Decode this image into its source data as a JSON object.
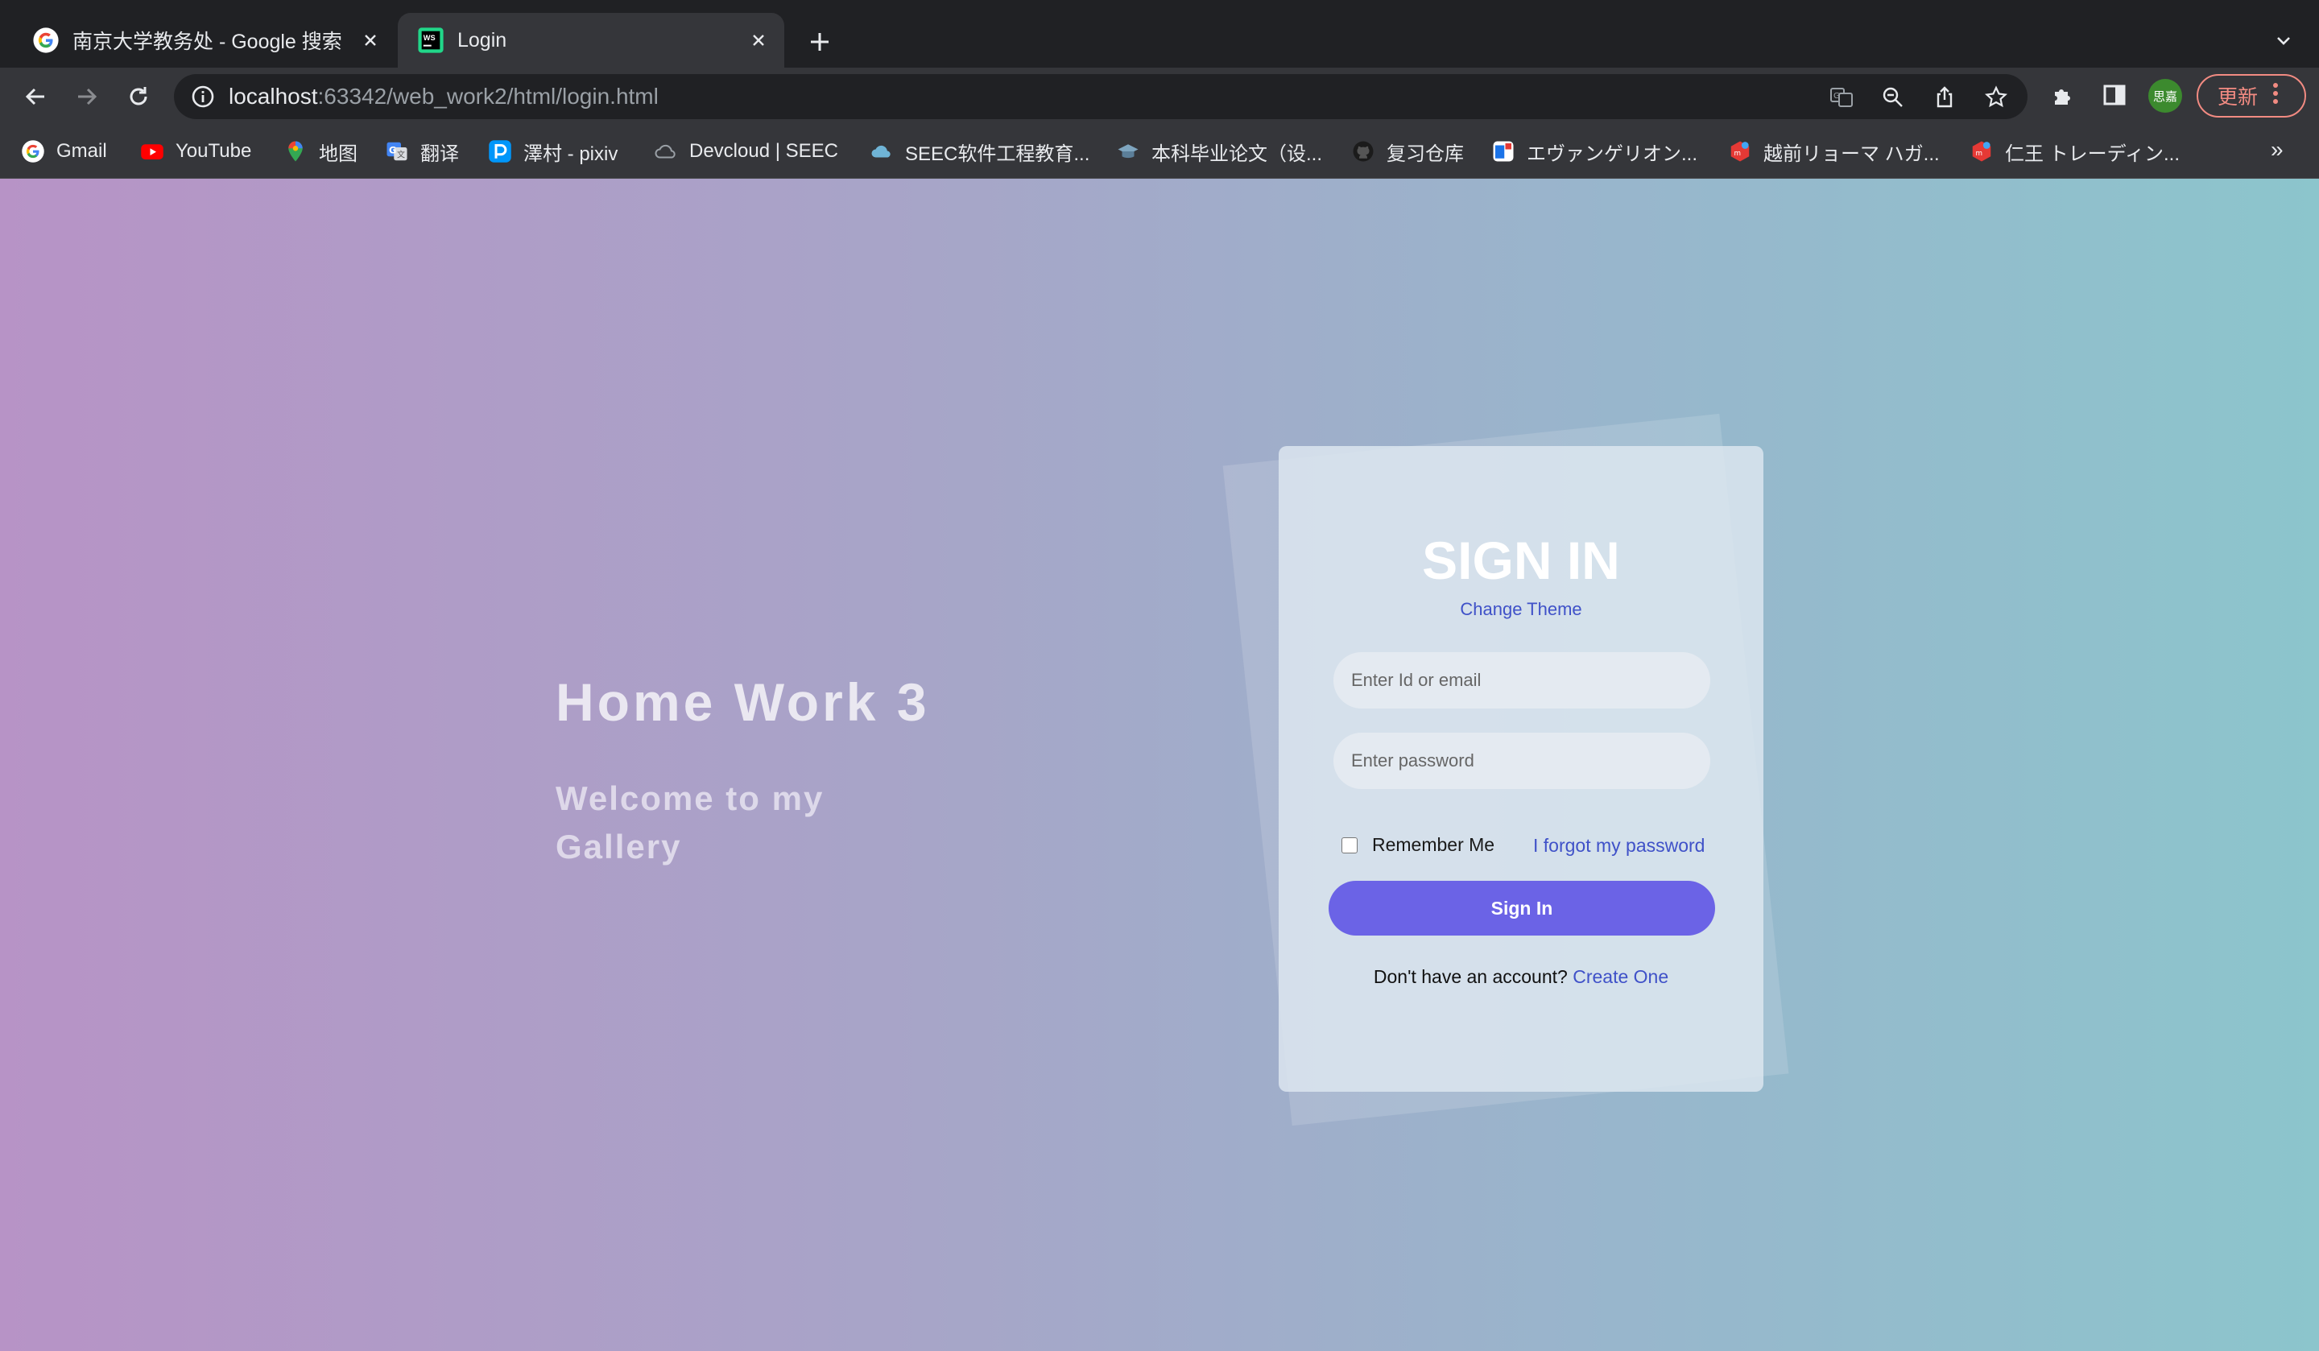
{
  "browser": {
    "tabs": [
      {
        "title": "南京大学教务处 - Google 搜索",
        "active": false
      },
      {
        "title": "Login",
        "active": true
      }
    ],
    "url_host": "localhost",
    "url_rest": ":63342/web_work2/html/login.html",
    "profile_label": "思嘉",
    "update_label": "更新",
    "bookmarks": [
      {
        "label": "Gmail",
        "icon": "google-icon"
      },
      {
        "label": "YouTube",
        "icon": "youtube-icon"
      },
      {
        "label": "地图",
        "icon": "maps-icon"
      },
      {
        "label": "翻译",
        "icon": "translate-icon"
      },
      {
        "label": "澤村 - pixiv",
        "icon": "pixiv-icon"
      },
      {
        "label": "Devcloud | SEEC",
        "icon": "cloud-icon"
      },
      {
        "label": "SEEC软件工程教育...",
        "icon": "cloud-icon"
      },
      {
        "label": "本科毕业论文（设...",
        "icon": "graduation-icon"
      },
      {
        "label": "复习仓库",
        "icon": "github-icon"
      },
      {
        "label": "エヴァンゲリオン...",
        "icon": "bilibili-icon"
      },
      {
        "label": "越前リョーマ ハガ...",
        "icon": "game-icon"
      },
      {
        "label": "仁王 トレーディン...",
        "icon": "game-icon"
      }
    ],
    "bookmarks_more": "»"
  },
  "hero": {
    "title": "Home Work 3",
    "subtitle": "Welcome to my Gallery"
  },
  "login": {
    "title": "SIGN IN",
    "change_theme": "Change Theme",
    "id_placeholder": "Enter Id or email",
    "password_placeholder": "Enter password",
    "remember_me": "Remember Me",
    "forgot_password": "I forgot my password",
    "sign_in_button": "Sign In",
    "no_account_text": "Don't have an account?",
    "create_one": "Create One"
  },
  "colors": {
    "accent": "#6b63e6",
    "link": "#3f51c8",
    "gradient_left": "#b793c6",
    "gradient_right": "#8cc5cc"
  }
}
